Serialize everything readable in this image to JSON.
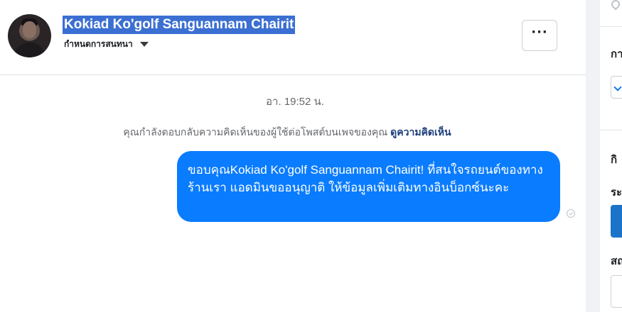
{
  "header": {
    "contact_name": "Kokiad Ko'golf Sanguannam Chairit",
    "manage_label": "กำหนดการสนทนา"
  },
  "conversation": {
    "timestamp": "อา. 19:52 น.",
    "notice_text": "คุณกำลังตอบกลับความคิดเห็นของผู้ใช้ต่อโพสต์บนเพจของคุณ",
    "notice_link": "ดูความคิดเห็น",
    "messages": [
      {
        "direction": "outgoing",
        "text": "ขอบคุณKokiad Ko'golf Sanguannam Chairit! ที่สนใจรถยนต์ของทางร้านเรา แอดมินขออนุญาติ ให้ข้อมูลเพิ่มเติมทางอินบ็อกซ์นะคะ",
        "status": "sent"
      }
    ]
  },
  "right_panel": {
    "labels": [
      "กา",
      "กิ",
      "ระ",
      "สถ"
    ]
  },
  "icons": {
    "more": "more-dots-icon",
    "dropdown": "caret-down-icon",
    "sent": "sent-check-icon",
    "location": "location-pin-icon"
  },
  "colors": {
    "bubble": "#0a7cff",
    "name_highlight": "#3b6fd2",
    "accent_button": "#1b74c8"
  }
}
